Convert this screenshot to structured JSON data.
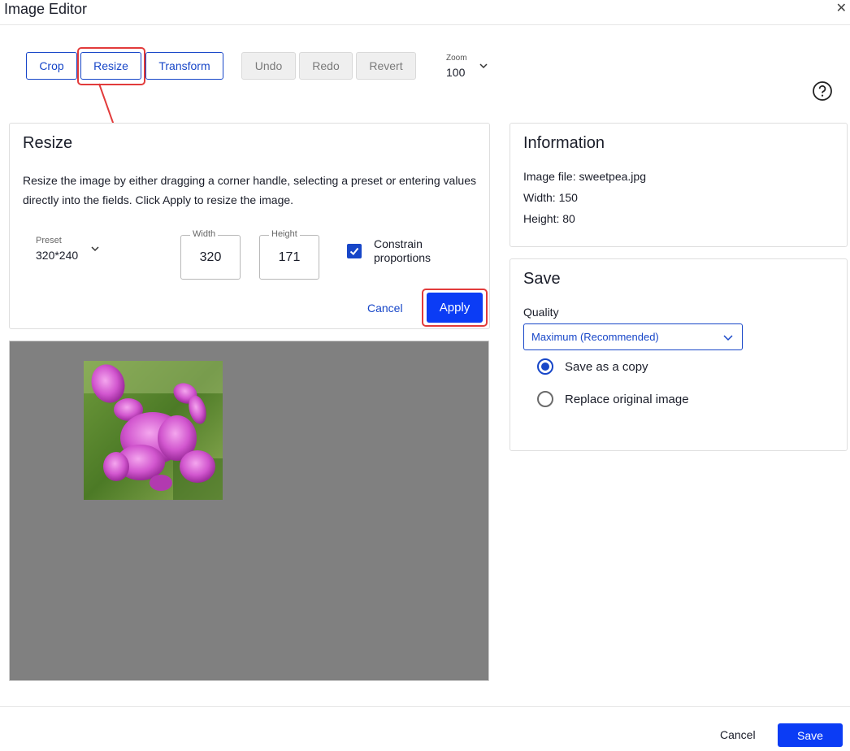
{
  "window": {
    "title": "Image Editor",
    "close_glyph": "✕"
  },
  "toolbar": {
    "crop_label": "Crop",
    "resize_label": "Resize",
    "transform_label": "Transform",
    "undo_label": "Undo",
    "redo_label": "Redo",
    "revert_label": "Revert",
    "zoom_label": "Zoom",
    "zoom_value": "100",
    "help_icon": "question-circle-icon"
  },
  "resize_panel": {
    "title": "Resize",
    "description": "Resize the image by either dragging a corner handle, selecting a preset or entering values directly into the fields. Click Apply to resize the image.",
    "preset_label": "Preset",
    "preset_value": "320*240",
    "width_label": "Width",
    "width_value": "320",
    "height_label": "Height",
    "height_value": "171",
    "constrain_label": "Constrain proportions",
    "constrain_checked": true,
    "cancel_label": "Cancel",
    "apply_label": "Apply"
  },
  "info_panel": {
    "title": "Information",
    "image_file": "Image file: sweetpea.jpg",
    "width": "Width: 150",
    "height": "Height: 80"
  },
  "save_panel": {
    "title": "Save",
    "quality_label": "Quality",
    "quality_value": "Maximum (Recommended)",
    "options": [
      {
        "label": "Save as a copy",
        "selected": true
      },
      {
        "label": "Replace original image",
        "selected": false
      }
    ]
  },
  "footer": {
    "cancel_label": "Cancel",
    "save_label": "Save"
  },
  "colors": {
    "accent": "#1746c8",
    "primary_button": "#0b3cf5",
    "annotation": "#e23b3b",
    "canvas_bg": "#808080"
  }
}
